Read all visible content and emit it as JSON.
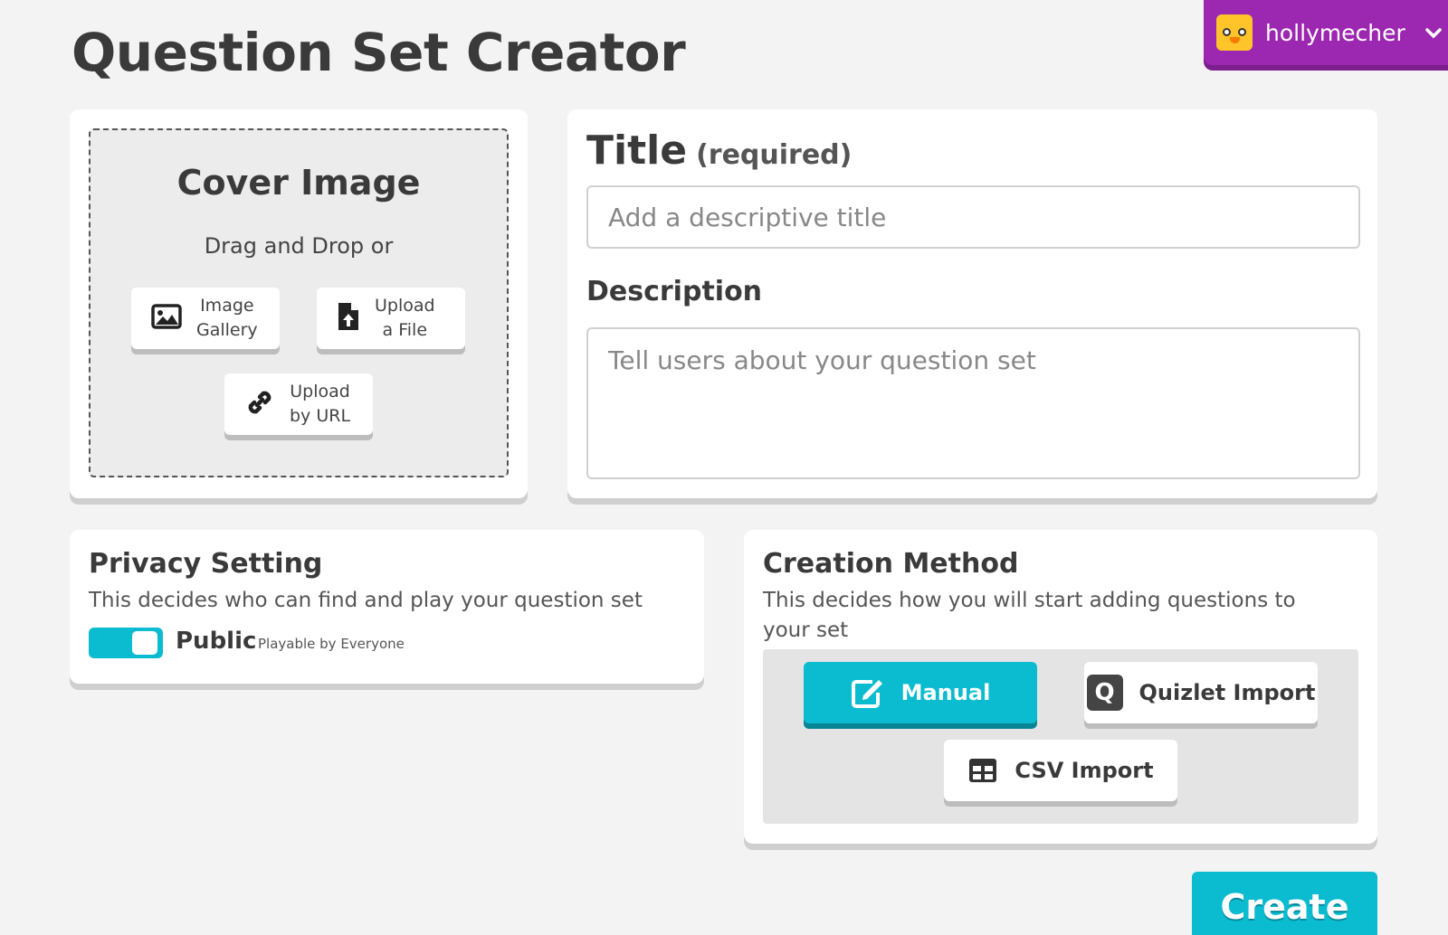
{
  "page": {
    "title": "Question Set Creator"
  },
  "user": {
    "name": "hollymecher"
  },
  "cover": {
    "title": "Cover Image",
    "subtitle": "Drag and Drop or",
    "gallery_label": "Image\nGallery",
    "file_label": "Upload\na File",
    "url_label": "Upload\nby URL"
  },
  "form": {
    "title_label": "Title",
    "title_required": "(required)",
    "title_placeholder": "Add a descriptive title",
    "description_label": "Description",
    "description_placeholder": "Tell users about your question set"
  },
  "privacy": {
    "heading": "Privacy Setting",
    "text": "This decides who can find and play your question set",
    "toggle_state": "on",
    "option_label": "Public",
    "option_sub": "Playable by Everyone",
    "accent": "#0bbcd0"
  },
  "method": {
    "heading": "Creation Method",
    "text": "This decides how you will start adding questions to your set",
    "manual_label": "Manual",
    "quizlet_label": "Quizlet Import",
    "csv_label": "CSV Import",
    "selected": "Manual"
  },
  "actions": {
    "create_label": "Create"
  },
  "colors": {
    "accent": "#0bbcd0",
    "user_bar": "#9c27b0",
    "background": "#f3f3f3"
  }
}
